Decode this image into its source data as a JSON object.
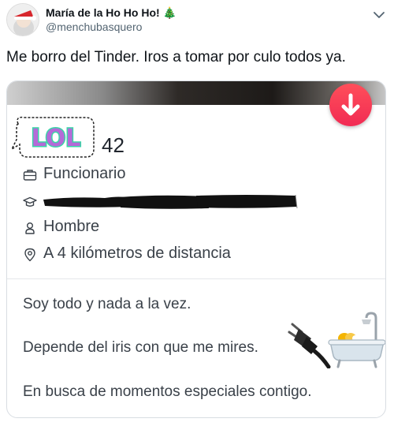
{
  "tweet": {
    "display_name": "María de la Ho Ho Ho! 🎄",
    "handle": "@menchubasquero",
    "text": "Me borro del Tinder. Iros a tomar por culo todos ya."
  },
  "profile_card": {
    "sticker_text": "LOL",
    "age": "42",
    "job": "Funcionario",
    "school": "",
    "gender": "Hombre",
    "distance": "A 4 kilómetros de distancia",
    "bio": [
      "Soy todo y nada a la vez.",
      "Depende del iris con que me mires.",
      "En busca de momentos especiales contigo."
    ],
    "icons": {
      "pass_button": "arrow-down-icon",
      "job": "briefcase-icon",
      "school": "graduation-cap-icon",
      "gender": "person-icon",
      "distance": "location-pin-icon",
      "emoji_1": "electric-plug-emoji",
      "emoji_2": "bathtub-emoji"
    },
    "colors": {
      "pass_button": "#f12b53",
      "sticker_fill": "#b56ad8",
      "sticker_outline": "#3bd5a8"
    }
  }
}
